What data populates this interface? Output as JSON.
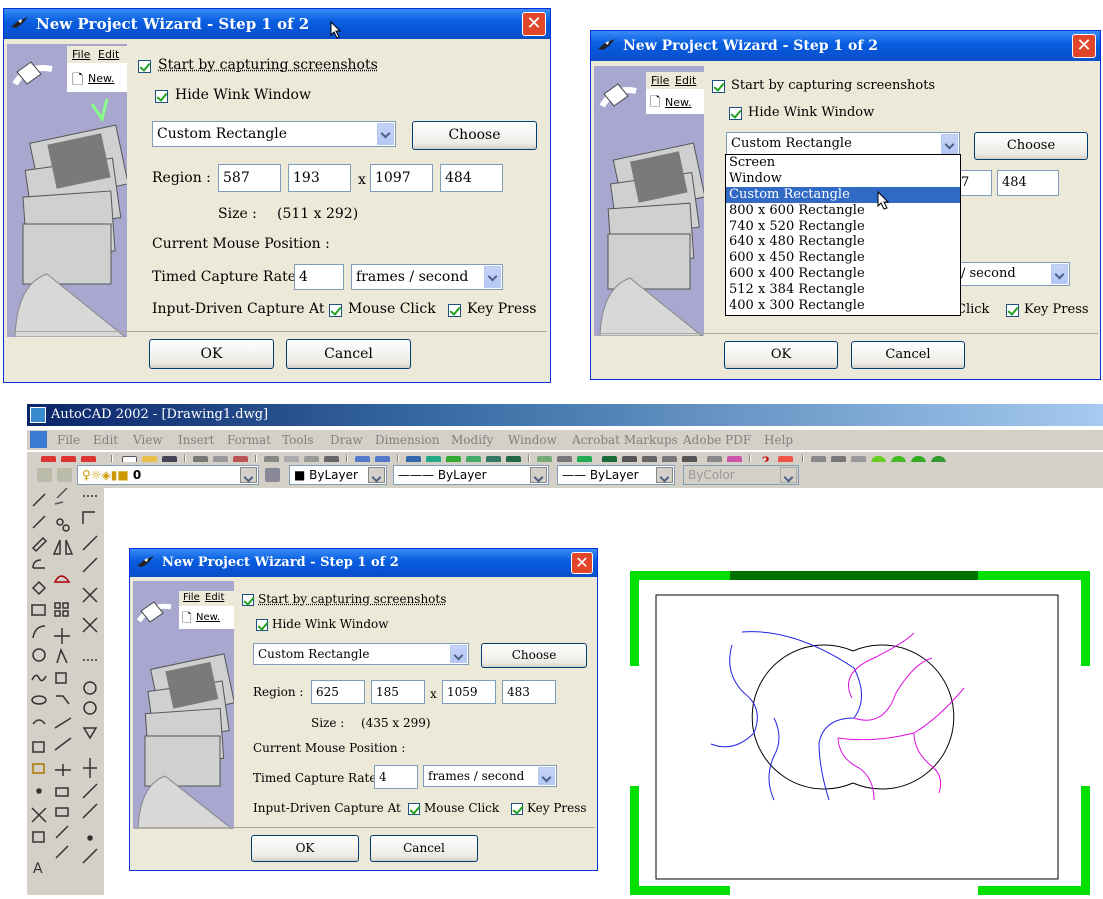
{
  "wizard": {
    "title": "New Project Wizard - Step 1 of 2",
    "menu_file": "File",
    "menu_edit": "Edit",
    "menu_new": "New.",
    "start_capture_label": "Start by capturing screenshots",
    "hide_wink_label": "Hide Wink Window",
    "capture_mode": "Custom Rectangle",
    "choose_label": "Choose",
    "region_label": "Region :",
    "x_label": "x",
    "size_label": "Size :",
    "current_mouse_label": "Current Mouse Position :",
    "timed_rate_label": "Timed Capture Rate",
    "rate_value": "4",
    "rate_unit": "frames / second",
    "input_driven_label": "Input-Driven Capture At",
    "mouse_click_label": "Mouse Click",
    "key_press_label": "Key Press",
    "ok_label": "OK",
    "cancel_label": "Cancel"
  },
  "dialog1": {
    "region": [
      "587",
      "193",
      "1097",
      "484"
    ],
    "size": "(511 x 292)"
  },
  "dialog2": {
    "region_partial": [
      "7",
      "484"
    ],
    "rate_unit_partial": "/ second",
    "mouse_click_partial": "Click",
    "dropdown_options": [
      "Screen",
      "Window",
      "Custom Rectangle",
      "800 x 600 Rectangle",
      "740 x 520 Rectangle",
      "640 x 480 Rectangle",
      "600 x 450 Rectangle",
      "600 x 400 Rectangle",
      "512 x 384 Rectangle",
      "400 x 300 Rectangle"
    ],
    "highlighted_option": "Custom Rectangle"
  },
  "dialog3": {
    "region": [
      "625",
      "185",
      "1059",
      "483"
    ],
    "size": "(435 x 299)"
  },
  "autocad": {
    "title": "AutoCAD 2002 - [Drawing1.dwg]",
    "menus": [
      "File",
      "Edit",
      "View",
      "Insert",
      "Format",
      "Tools",
      "Draw",
      "Dimension",
      "Modify",
      "Window",
      "Acrobat Markups",
      "Adobe PDF",
      "Help"
    ],
    "layer_value": "0",
    "color_value": "ByLayer",
    "linetype_value": "ByLayer",
    "lineweight_value": "ByLayer",
    "plotstyle_value": "ByColor"
  },
  "colors": {
    "frame_green": "#00e000",
    "frame_dark_green": "#007000",
    "blue_curve": "#2020e0",
    "magenta_curve": "#e010e0"
  }
}
